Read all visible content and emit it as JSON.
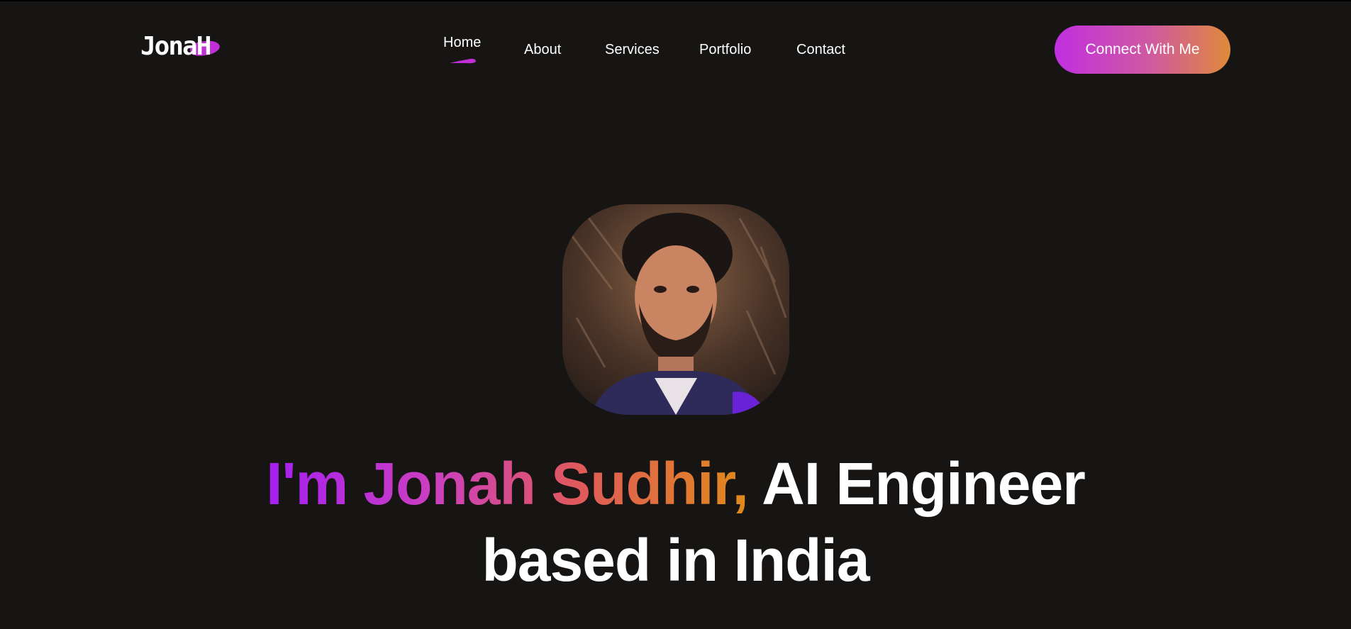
{
  "brand": {
    "logo_text": "JonaH",
    "accent": "#c02fd6"
  },
  "nav": {
    "items": [
      {
        "label": "Home",
        "active": true
      },
      {
        "label": "About",
        "active": false
      },
      {
        "label": "Services",
        "active": false
      },
      {
        "label": "Portfolio",
        "active": false
      },
      {
        "label": "Contact",
        "active": false
      }
    ]
  },
  "cta": {
    "label": "Connect With Me"
  },
  "hero": {
    "portrait_icon": "profile-photo",
    "headline_gradient": "I'm Jonah Sudhir,",
    "headline_rest": "AI Engineer",
    "headline_line2": "based in India"
  },
  "colors": {
    "background": "#161513",
    "gradient_start": "#a51ff0",
    "gradient_end": "#e08a1a"
  }
}
